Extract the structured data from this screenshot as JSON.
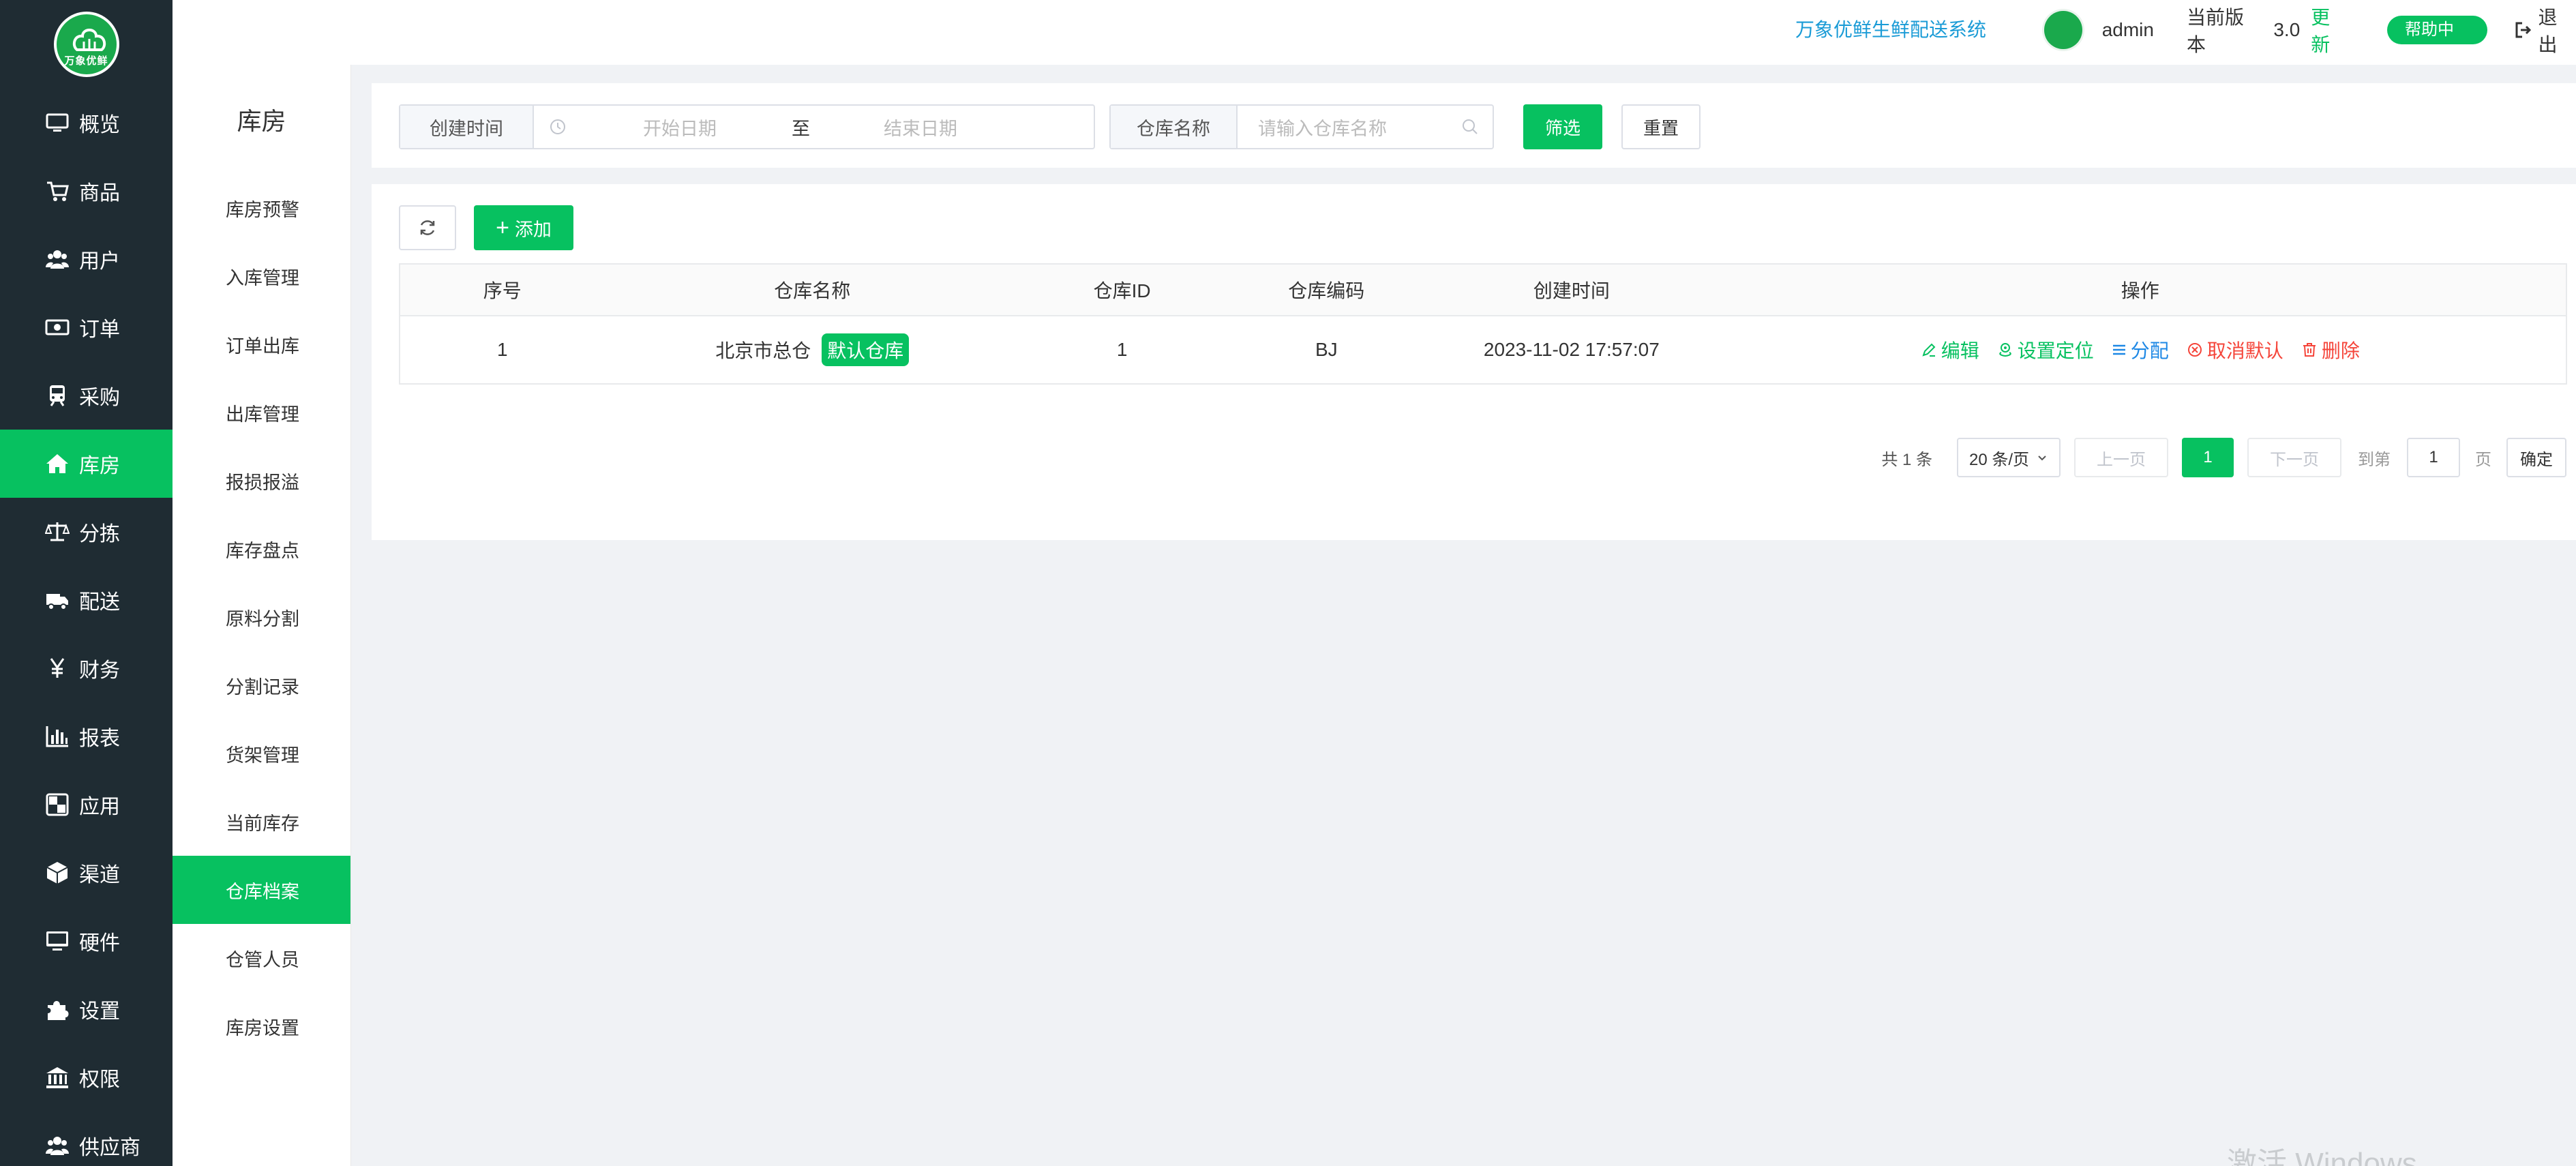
{
  "app": {
    "brand": "万象优鲜生鲜配送系统",
    "logo_text": "万象优鲜"
  },
  "header": {
    "username": "admin",
    "version_label": "当前版本",
    "version_number": "3.0",
    "update_label": "更新",
    "help_label": "帮助中心",
    "logout_label": "退出"
  },
  "nav": {
    "items": [
      {
        "label": "概览",
        "icon": "monitor-icon"
      },
      {
        "label": "商品",
        "icon": "cart-icon"
      },
      {
        "label": "用户",
        "icon": "users-icon"
      },
      {
        "label": "订单",
        "icon": "money-icon"
      },
      {
        "label": "采购",
        "icon": "train-icon"
      },
      {
        "label": "库房",
        "icon": "home-icon",
        "active": true
      },
      {
        "label": "分拣",
        "icon": "scale-icon"
      },
      {
        "label": "配送",
        "icon": "truck-icon"
      },
      {
        "label": "财务",
        "icon": "yen-icon"
      },
      {
        "label": "报表",
        "icon": "bar-chart-icon"
      },
      {
        "label": "应用",
        "icon": "apps-icon"
      },
      {
        "label": "渠道",
        "icon": "cube-icon"
      },
      {
        "label": "硬件",
        "icon": "desktop-icon"
      },
      {
        "label": "设置",
        "icon": "puzzle-icon"
      },
      {
        "label": "权限",
        "icon": "bank-icon"
      },
      {
        "label": "供应商",
        "icon": "group-icon"
      }
    ]
  },
  "submenu": {
    "title": "库房",
    "items": [
      {
        "label": "库房预警"
      },
      {
        "label": "入库管理"
      },
      {
        "label": "订单出库"
      },
      {
        "label": "出库管理"
      },
      {
        "label": "报损报溢"
      },
      {
        "label": "库存盘点"
      },
      {
        "label": "原料分割"
      },
      {
        "label": "分割记录"
      },
      {
        "label": "货架管理"
      },
      {
        "label": "当前库存"
      },
      {
        "label": "仓库档案",
        "active": true
      },
      {
        "label": "仓管人员"
      },
      {
        "label": "库房设置"
      }
    ]
  },
  "filter": {
    "created_label": "创建时间",
    "start_placeholder": "开始日期",
    "range_sep": "至",
    "end_placeholder": "结束日期",
    "name_label": "仓库名称",
    "name_placeholder": "请输入仓库名称",
    "filter_btn": "筛选",
    "reset_btn": "重置"
  },
  "toolbar": {
    "add_label": "添加"
  },
  "table": {
    "columns": [
      "序号",
      "仓库名称",
      "仓库ID",
      "仓库编码",
      "创建时间",
      "操作"
    ],
    "rows": [
      {
        "index": "1",
        "name": "北京市总仓",
        "default_tag": "默认仓库",
        "id": "1",
        "code": "BJ",
        "created": "2023-11-02 17:57:07",
        "actions": {
          "edit": "编辑",
          "locate": "设置定位",
          "distribute": "分配",
          "cancel_default": "取消默认",
          "delete": "删除"
        }
      }
    ]
  },
  "pagination": {
    "total": "共 1 条",
    "page_size": "20 条/页",
    "prev": "上一页",
    "current": "1",
    "next": "下一页",
    "goto": "到第",
    "page_input": "1",
    "page_unit": "页",
    "confirm": "确定"
  },
  "watermark": "激活 Windows",
  "colors": {
    "accent": "#07c160",
    "sidebar_bg": "#1f2c33",
    "brand_text": "#1a9bd6",
    "link_blue": "#1e88e5",
    "danger": "#f5453a"
  }
}
